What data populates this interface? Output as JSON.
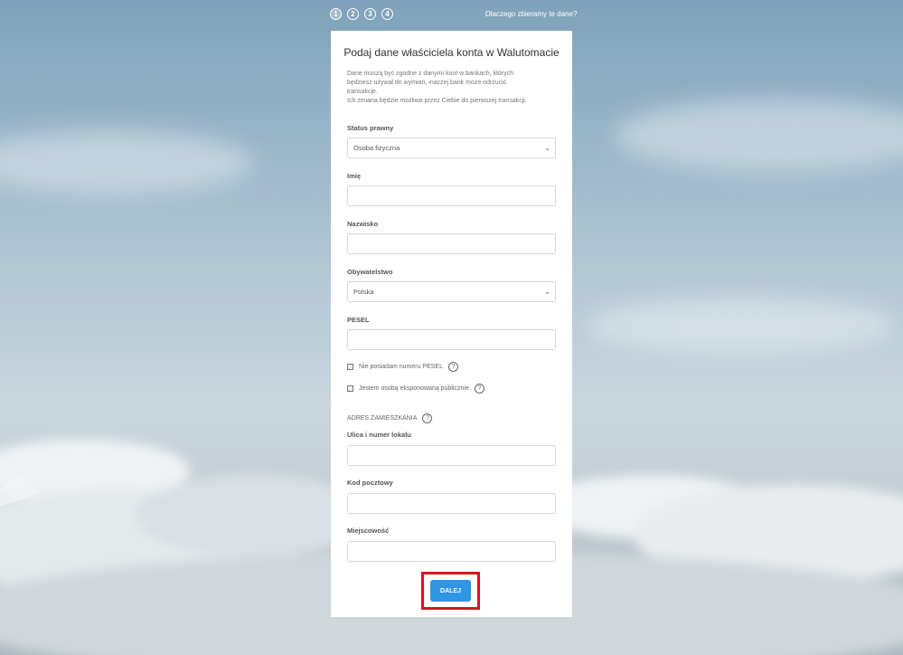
{
  "steps": [
    "1",
    "2",
    "3",
    "4"
  ],
  "why_link": "Dlaczego zbieramy te dane?",
  "form": {
    "title": "Podaj dane właściciela konta w Walutomacie",
    "intro_line1": "Dane muszą być zgodne z danymi kont w bankach, których",
    "intro_line2": "będziesz używał do wymian, inaczej bank może odrzucić",
    "intro_line3": "transakcje.",
    "intro_line4": "Ich zmiana będzie możliwa przez Ciebie do pierwszej transakcji.",
    "status": {
      "label": "Status prawny",
      "value": "Osoba fizyczna"
    },
    "first_name": {
      "label": "Imię",
      "value": ""
    },
    "last_name": {
      "label": "Nazwisko",
      "value": ""
    },
    "citizenship": {
      "label": "Obywatelstwo",
      "value": "Polska"
    },
    "pesel": {
      "label": "PESEL",
      "value": ""
    },
    "no_pesel": {
      "label": "Nie posiadam numeru PESEL",
      "checked": false
    },
    "pep": {
      "label": "Jestem osobą eksponowaną publicznie",
      "checked": false
    },
    "address_section": "ADRES ZAMIESZKANIA",
    "street": {
      "label": "Ulica i numer lokalu",
      "value": ""
    },
    "postal_code": {
      "label": "Kod pocztowy",
      "value": ""
    },
    "city": {
      "label": "Miejscowość",
      "value": ""
    },
    "help_glyph": "?",
    "chevron_glyph": "⌄",
    "submit_label": "DALEJ"
  },
  "colors": {
    "accent": "#2f96e6",
    "highlight": "#d7141f",
    "card": "#ffffff"
  }
}
